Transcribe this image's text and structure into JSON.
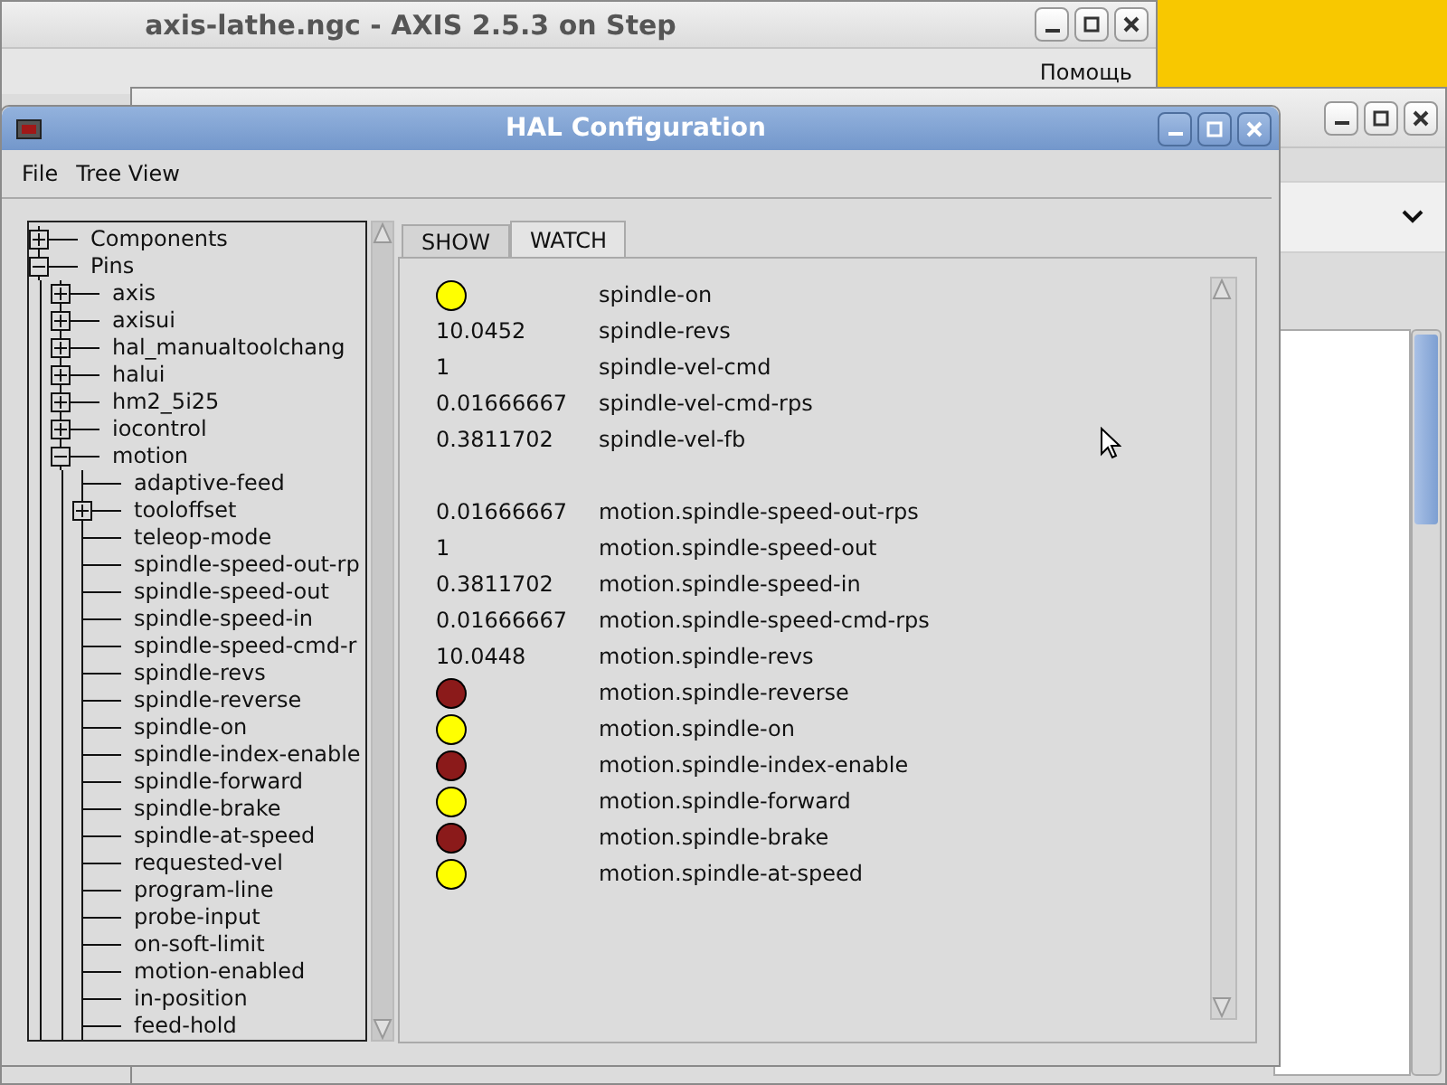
{
  "back_window": {
    "title": "axis-lathe.ngc - AXIS 2.5.3 on Step",
    "menu": [
      "Помощь"
    ]
  },
  "hal_window": {
    "title": "HAL Configuration",
    "menu": [
      "File",
      "Tree View"
    ],
    "tree": [
      {
        "label": "Components",
        "expanded": false
      },
      {
        "label": "Pins",
        "expanded": true,
        "children": [
          {
            "label": "axis",
            "expanded": false
          },
          {
            "label": "axisui",
            "expanded": false
          },
          {
            "label": "hal_manualtoolchang",
            "expanded": false
          },
          {
            "label": "halui",
            "expanded": false
          },
          {
            "label": "hm2_5i25",
            "expanded": false
          },
          {
            "label": "iocontrol",
            "expanded": false
          },
          {
            "label": "motion",
            "expanded": true,
            "children": [
              {
                "label": "adaptive-feed"
              },
              {
                "label": "tooloffset",
                "expanded": false
              },
              {
                "label": "teleop-mode"
              },
              {
                "label": "spindle-speed-out-rp"
              },
              {
                "label": "spindle-speed-out"
              },
              {
                "label": "spindle-speed-in"
              },
              {
                "label": "spindle-speed-cmd-r"
              },
              {
                "label": "spindle-revs"
              },
              {
                "label": "spindle-reverse"
              },
              {
                "label": "spindle-on"
              },
              {
                "label": "spindle-index-enable"
              },
              {
                "label": "spindle-forward"
              },
              {
                "label": "spindle-brake"
              },
              {
                "label": "spindle-at-speed"
              },
              {
                "label": "requested-vel"
              },
              {
                "label": "program-line"
              },
              {
                "label": "probe-input"
              },
              {
                "label": "on-soft-limit"
              },
              {
                "label": "motion-enabled"
              },
              {
                "label": "in-position"
              },
              {
                "label": "feed-hold"
              }
            ]
          }
        ]
      }
    ],
    "tabs": [
      {
        "label": "SHOW",
        "selected": false
      },
      {
        "label": "WATCH",
        "selected": true
      }
    ],
    "watch_groups": [
      [
        {
          "kind": "led",
          "on": true,
          "name": "spindle-on"
        },
        {
          "kind": "value",
          "value": "10.0452",
          "name": "spindle-revs"
        },
        {
          "kind": "value",
          "value": "1",
          "name": "spindle-vel-cmd"
        },
        {
          "kind": "value",
          "value": "0.01666667",
          "name": "spindle-vel-cmd-rps"
        },
        {
          "kind": "value",
          "value": "0.3811702",
          "name": "spindle-vel-fb"
        }
      ],
      [
        {
          "kind": "value",
          "value": "0.01666667",
          "name": "motion.spindle-speed-out-rps"
        },
        {
          "kind": "value",
          "value": "1",
          "name": "motion.spindle-speed-out"
        },
        {
          "kind": "value",
          "value": "0.3811702",
          "name": "motion.spindle-speed-in"
        },
        {
          "kind": "value",
          "value": "0.01666667",
          "name": "motion.spindle-speed-cmd-rps"
        },
        {
          "kind": "value",
          "value": "10.0448",
          "name": "motion.spindle-revs"
        },
        {
          "kind": "led",
          "on": false,
          "name": "motion.spindle-reverse"
        },
        {
          "kind": "led",
          "on": true,
          "name": "motion.spindle-on"
        },
        {
          "kind": "led",
          "on": false,
          "name": "motion.spindle-index-enable"
        },
        {
          "kind": "led",
          "on": true,
          "name": "motion.spindle-forward"
        },
        {
          "kind": "led",
          "on": false,
          "name": "motion.spindle-brake"
        },
        {
          "kind": "led",
          "on": true,
          "name": "motion.spindle-at-speed"
        }
      ]
    ]
  }
}
